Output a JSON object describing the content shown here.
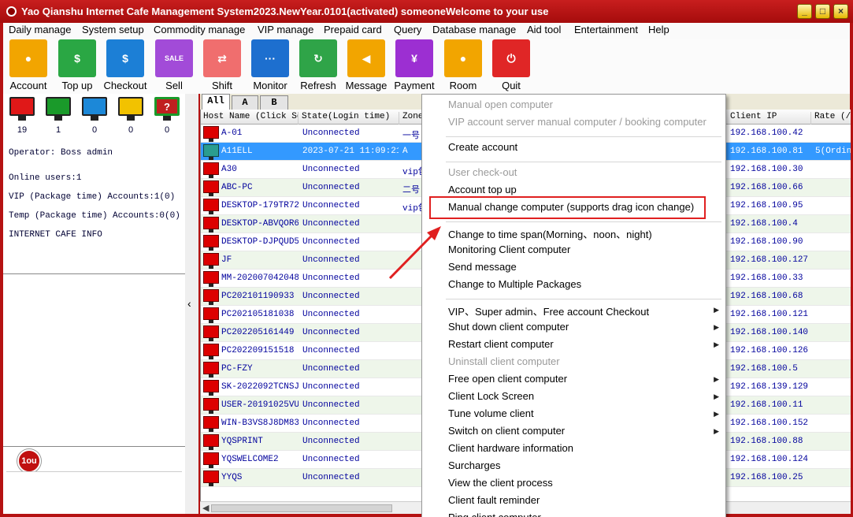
{
  "window": {
    "title": "Yao Qianshu Internet Cafe Management System2023.NewYear.0101(activated)  someoneWelcome to your use",
    "controls": [
      "_",
      "□",
      "×"
    ]
  },
  "menu": [
    "Daily manage",
    "System setup",
    "Commodity manage",
    "VIP manage",
    "Prepaid card",
    "Query",
    "Database manage",
    "Aid tool",
    "Entertainment",
    "Help"
  ],
  "toolbar": [
    {
      "label": "Account",
      "color": "#f2a500",
      "icon": "user-icon"
    },
    {
      "label": "Top up",
      "color": "#2aa744",
      "icon": "money-bag-icon"
    },
    {
      "label": "Checkout",
      "color": "#1c7fd6",
      "icon": "bill-icon"
    },
    {
      "label": "Sell",
      "color": "#a24bd8",
      "icon": "sale-tag-icon"
    },
    {
      "label": "Shift",
      "color": "#f06e6e",
      "icon": "shift-icon"
    },
    {
      "label": "Monitor",
      "color": "#1d6fcf",
      "icon": "monitor-icon"
    },
    {
      "label": "Refresh",
      "color": "#2fa448",
      "icon": "refresh-icon"
    },
    {
      "label": "Message",
      "color": "#f2a500",
      "icon": "megaphone-icon"
    },
    {
      "label": "Payment",
      "color": "#9c2fd2",
      "icon": "payment-icon"
    },
    {
      "label": "Room",
      "color": "#f2a500",
      "icon": "room-user-icon"
    },
    {
      "label": "Quit",
      "color": "#e02626",
      "icon": "power-icon"
    }
  ],
  "status_monitors": [
    {
      "color": "#e01818",
      "count": "19"
    },
    {
      "color": "#1a9a2a",
      "count": "1"
    },
    {
      "color": "#1c88d8",
      "count": "0"
    },
    {
      "color": "#f2c200",
      "count": "0"
    },
    {
      "color": "#1a9a2a",
      "count": "0",
      "symbol": "?"
    }
  ],
  "left_info": {
    "operator": "Operator: Boss admin",
    "online": "Online users:1",
    "vip": "VIP (Package time) Accounts:1(0)",
    "temp": "Temp (Package time) Accounts:0(0)",
    "cafe": "INTERNET CAFE  INFO"
  },
  "logo_text": "1ou",
  "tabs": [
    "All",
    "A",
    "B"
  ],
  "columns": [
    "Host Name (Click So",
    "State(Login time)",
    "Zone",
    "Client IP",
    "Rate (/h"
  ],
  "rows": [
    {
      "host": "A-01",
      "state": "Unconnected",
      "zone": "一号",
      "ip": "192.168.100.42",
      "rate": ""
    },
    {
      "host": "A11ELL",
      "state": "2023-07-21 11:09:21",
      "zone": "A",
      "ip": "192.168.100.81",
      "rate": "5(Ordina"
    },
    {
      "host": "A30",
      "state": "Unconnected",
      "zone": "vip包",
      "ip": "192.168.100.30",
      "rate": ""
    },
    {
      "host": "ABC-PC",
      "state": "Unconnected",
      "zone": "二号",
      "ip": "192.168.100.66",
      "rate": ""
    },
    {
      "host": "DESKTOP-179TR72",
      "state": "Unconnected",
      "zone": "vip包",
      "ip": "192.168.100.95",
      "rate": ""
    },
    {
      "host": "DESKTOP-ABVQOR6",
      "state": "Unconnected",
      "zone": "",
      "ip": "192.168.100.4",
      "rate": ""
    },
    {
      "host": "DESKTOP-DJPQUD5",
      "state": "Unconnected",
      "zone": "",
      "ip": "192.168.100.90",
      "rate": ""
    },
    {
      "host": "JF",
      "state": "Unconnected",
      "zone": "",
      "ip": "192.168.100.127",
      "rate": ""
    },
    {
      "host": "MM-202007042048",
      "state": "Unconnected",
      "zone": "",
      "ip": "192.168.100.33",
      "rate": ""
    },
    {
      "host": "PC202101190933",
      "state": "Unconnected",
      "zone": "",
      "ip": "192.168.100.68",
      "rate": ""
    },
    {
      "host": "PC202105181038",
      "state": "Unconnected",
      "zone": "",
      "ip": "192.168.100.121",
      "rate": ""
    },
    {
      "host": "PC202205161449",
      "state": "Unconnected",
      "zone": "",
      "ip": "192.168.100.140",
      "rate": ""
    },
    {
      "host": "PC202209151518",
      "state": "Unconnected",
      "zone": "",
      "ip": "192.168.100.126",
      "rate": ""
    },
    {
      "host": "PC-FZY",
      "state": "Unconnected",
      "zone": "",
      "ip": "192.168.100.5",
      "rate": ""
    },
    {
      "host": "SK-2022092TCNSJ",
      "state": "Unconnected",
      "zone": "",
      "ip": "192.168.139.129",
      "rate": ""
    },
    {
      "host": "USER-20191025VU",
      "state": "Unconnected",
      "zone": "",
      "ip": "192.168.100.11",
      "rate": ""
    },
    {
      "host": "WIN-B3VS8J8DM83",
      "state": "Unconnected",
      "zone": "",
      "ip": "192.168.100.152",
      "rate": ""
    },
    {
      "host": "YQSPRINT",
      "state": "Unconnected",
      "zone": "",
      "ip": "192.168.100.88",
      "rate": ""
    },
    {
      "host": "YQSWELCOME2",
      "state": "Unconnected",
      "zone": "",
      "ip": "192.168.100.124",
      "rate": ""
    },
    {
      "host": "YYQS",
      "state": "Unconnected",
      "zone": "",
      "ip": "192.168.100.25",
      "rate": ""
    }
  ],
  "context_menu": [
    {
      "label": "Manual open computer",
      "disabled": true
    },
    {
      "label": "VIP account server manual computer / booking computer",
      "disabled": true
    },
    {
      "sep": true
    },
    {
      "label": "Create account"
    },
    {
      "sep": true
    },
    {
      "label": "User check-out",
      "disabled": true
    },
    {
      "label": "Account top up"
    },
    {
      "label": "Manual change computer (supports drag icon change)"
    },
    {
      "sep": true
    },
    {
      "label": "Change to time span(Morning、noon、night)"
    },
    {
      "label": "Monitoring Client computer"
    },
    {
      "label": "Send message"
    },
    {
      "label": "Change to Multiple Packages"
    },
    {
      "sep": true
    },
    {
      "label": "VIP、Super admin、Free account Checkout",
      "submenu": true
    },
    {
      "label": "Shut down client computer",
      "submenu": true
    },
    {
      "label": "Restart client computer",
      "submenu": true
    },
    {
      "label": "Uninstall client computer",
      "disabled": true
    },
    {
      "label": "Free open client computer",
      "submenu": true
    },
    {
      "label": "Client Lock Screen",
      "submenu": true
    },
    {
      "label": "Tune  volume client",
      "submenu": true
    },
    {
      "label": "Switch on client computer",
      "submenu": true
    },
    {
      "label": "Client hardware information"
    },
    {
      "label": "Surcharges"
    },
    {
      "label": "View the client process"
    },
    {
      "label": "Client fault reminder"
    },
    {
      "label": "Ping client computer"
    }
  ],
  "colors": {
    "titlebar": "#b51212",
    "selection": "#3399ff",
    "highlight_box": "#e02020"
  }
}
